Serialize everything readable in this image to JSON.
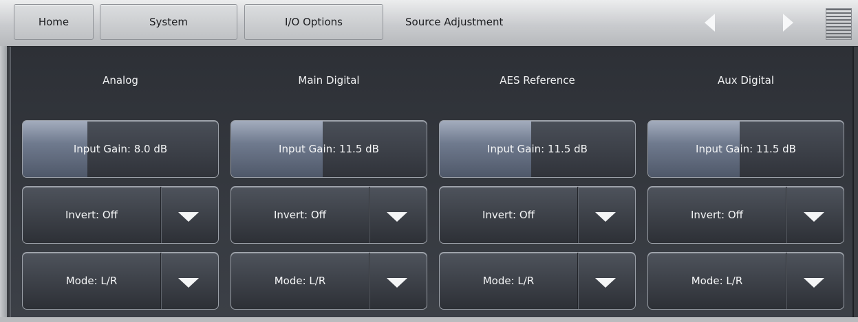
{
  "nav": {
    "tabs": [
      {
        "label": "Home"
      },
      {
        "label": "System"
      },
      {
        "label": "I/O Options"
      }
    ],
    "breadcrumb": "Source Adjustment"
  },
  "columns": [
    {
      "title": "Analog",
      "gain_label": "Input Gain: 8.0 dB",
      "invert_label": "Invert: Off",
      "mode_label": "Mode: L/R"
    },
    {
      "title": "Main Digital",
      "gain_label": "Input Gain: 11.5 dB",
      "invert_label": "Invert: Off",
      "mode_label": "Mode: L/R"
    },
    {
      "title": "AES Reference",
      "gain_label": "Input Gain: 11.5 dB",
      "invert_label": "Invert: Off",
      "mode_label": "Mode: L/R"
    },
    {
      "title": "Aux Digital",
      "gain_label": "Input Gain: 11.5 dB",
      "invert_label": "Invert: Off",
      "mode_label": "Mode: L/R"
    }
  ],
  "gain_fill_fractions": [
    0.33,
    0.47,
    0.47,
    0.47
  ],
  "icons": [
    "nav-back-arrow-icon",
    "nav-forward-arrow-icon",
    "menu-grid-icon",
    "dropdown-arrow-icon"
  ]
}
